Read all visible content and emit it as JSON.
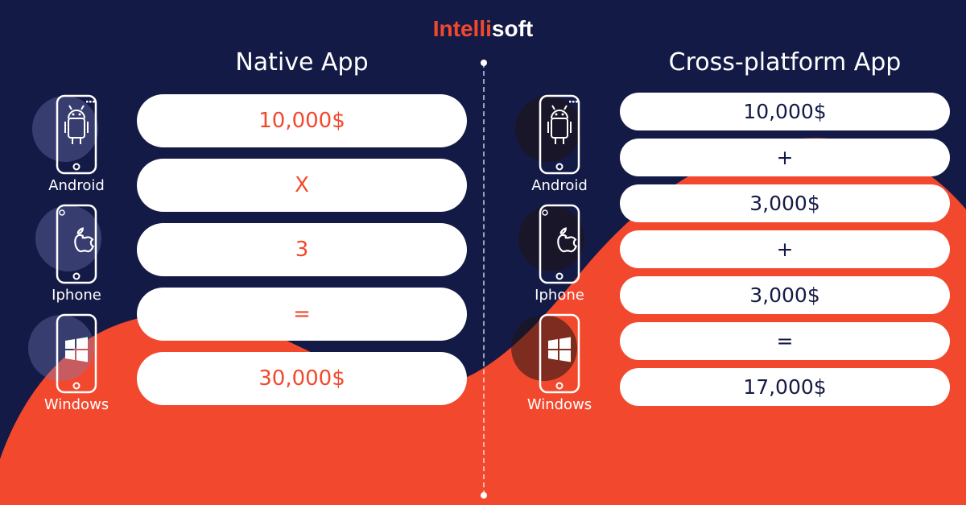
{
  "logo": {
    "part1": "Intelli",
    "part2": "soft"
  },
  "left": {
    "title": "Native App",
    "devices": [
      {
        "name": "Android"
      },
      {
        "name": "Iphone"
      },
      {
        "name": "Windows"
      }
    ],
    "pills": [
      {
        "text": "10,000$"
      },
      {
        "text": "X"
      },
      {
        "text": "3"
      },
      {
        "text": "="
      },
      {
        "text": "30,000$"
      }
    ]
  },
  "right": {
    "title": "Cross-platform App",
    "devices": [
      {
        "name": "Android"
      },
      {
        "name": "Iphone"
      },
      {
        "name": "Windows"
      }
    ],
    "pills": [
      {
        "text": "10,000$"
      },
      {
        "text": "+"
      },
      {
        "text": "3,000$"
      },
      {
        "text": "+"
      },
      {
        "text": "3,000$"
      },
      {
        "text": "="
      },
      {
        "text": "17,000$"
      }
    ]
  }
}
